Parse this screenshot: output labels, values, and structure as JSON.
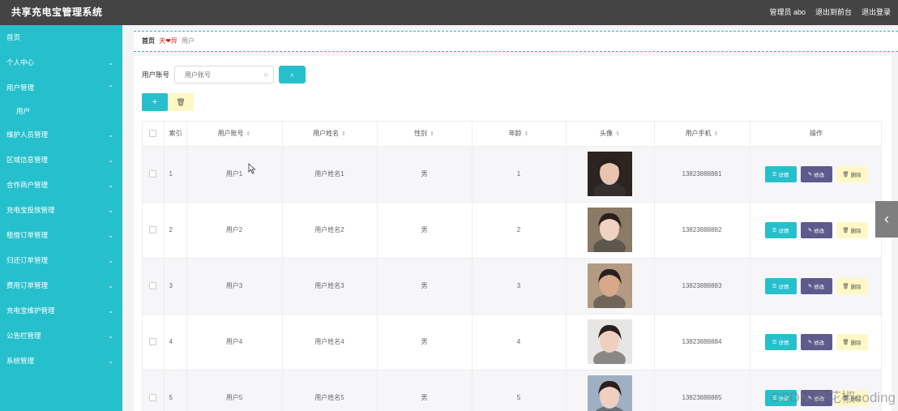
{
  "header": {
    "app_title": "共享充电宝管理系统",
    "admin": "管理员 abo",
    "back_front": "退出到前台",
    "logout": "退出登录"
  },
  "sidebar": {
    "items": [
      {
        "label": "首页",
        "has_arrow": false
      },
      {
        "label": "个人中心",
        "has_arrow": true
      },
      {
        "label": "用户管理",
        "has_arrow": true,
        "expanded": true
      },
      {
        "label": "维护人员管理",
        "has_arrow": true
      },
      {
        "label": "区域信息管理",
        "has_arrow": true
      },
      {
        "label": "合作商户管理",
        "has_arrow": true
      },
      {
        "label": "充电宝投放管理",
        "has_arrow": true
      },
      {
        "label": "租借订单管理",
        "has_arrow": true
      },
      {
        "label": "归还订单管理",
        "has_arrow": true
      },
      {
        "label": "费用订单管理",
        "has_arrow": true
      },
      {
        "label": "充电宝维护管理",
        "has_arrow": true
      },
      {
        "label": "公告栏管理",
        "has_arrow": true
      },
      {
        "label": "系统管理",
        "has_arrow": true
      }
    ],
    "sub_item": "用户"
  },
  "breadcrumb": {
    "home": "首页",
    "sep": "天❤异",
    "current": "用户"
  },
  "search": {
    "label": "用户账号",
    "placeholder": "用户账号"
  },
  "table": {
    "headers": [
      "",
      "索引",
      "用户账号",
      "用户姓名",
      "性别",
      "年龄",
      "头像",
      "用户手机",
      "操作"
    ],
    "rows": [
      {
        "index": "1",
        "account": "用户1",
        "name": "用户姓名1",
        "gender": "男",
        "age": "1",
        "phone": "13823888881",
        "avatar_bg": "#2b2420",
        "avatar_face": "#e9c2b0"
      },
      {
        "index": "2",
        "account": "用户2",
        "name": "用户姓名2",
        "gender": "男",
        "age": "2",
        "phone": "13823888882",
        "avatar_bg": "#8a7a66",
        "avatar_face": "#efd2c0"
      },
      {
        "index": "3",
        "account": "用户3",
        "name": "用户姓名3",
        "gender": "男",
        "age": "3",
        "phone": "13823888883",
        "avatar_bg": "#b39a82",
        "avatar_face": "#d8a88a"
      },
      {
        "index": "4",
        "account": "用户4",
        "name": "用户姓名4",
        "gender": "男",
        "age": "4",
        "phone": "13823888884",
        "avatar_bg": "#e8e6e4",
        "avatar_face": "#efd0bf"
      },
      {
        "index": "5",
        "account": "用户5",
        "name": "用户姓名5",
        "gender": "男",
        "age": "5",
        "phone": "13823888885",
        "avatar_bg": "#9fb0c4",
        "avatar_face": "#efd0c0"
      }
    ],
    "ops": {
      "detail": "详情",
      "edit": "修改",
      "delete": "删除"
    }
  },
  "watermark": "CSDN @花椒coding",
  "colors": {
    "accent": "#26c0cc",
    "topbar": "#444444",
    "edit": "#5f5a8c",
    "delete": "#fff8c6"
  }
}
